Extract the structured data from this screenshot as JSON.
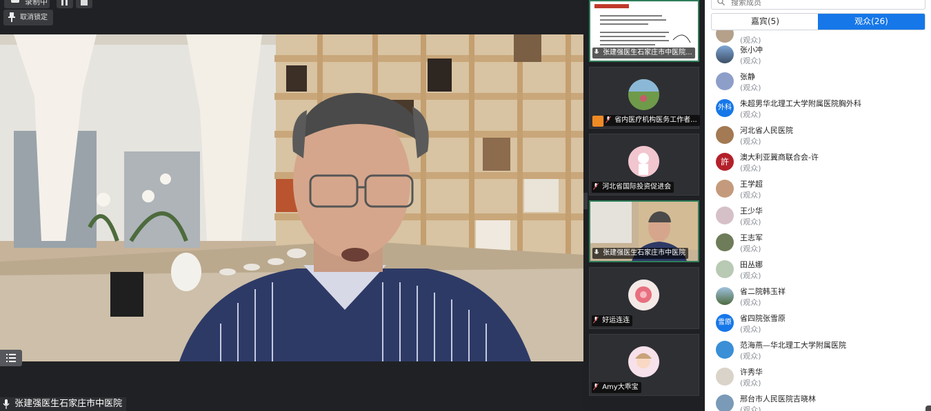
{
  "toolbar": {
    "recording_label": "录制中",
    "unlock_label": "取消锁定"
  },
  "main_video": {
    "speaker_name": "张建强医生石家庄市中医院"
  },
  "thumbnails": [
    {
      "label": "张建强医生石家庄市中医院...",
      "kind": "screen-share",
      "active": true
    },
    {
      "label": "省内医疗机构医务工作者...",
      "kind": "avatar",
      "host": true
    },
    {
      "label": "河北省国际投资促进会",
      "kind": "avatar"
    },
    {
      "label": "张建强医生石家庄市中医院",
      "kind": "video",
      "active": true
    },
    {
      "label": "好运连连",
      "kind": "avatar"
    },
    {
      "label": "Amy大乖宝",
      "kind": "avatar"
    }
  ],
  "panel": {
    "search_placeholder": "搜索成员",
    "tabs": [
      {
        "label": "嘉宾(5)",
        "selected": false
      },
      {
        "label": "观众(26)",
        "selected": true
      }
    ],
    "participants": [
      {
        "name": "",
        "role": "(观众)",
        "avatar": "photo"
      },
      {
        "name": "张小冲",
        "role": "(观众)",
        "avatar": "photo"
      },
      {
        "name": "张静",
        "role": "(观众)",
        "avatar": "photo"
      },
      {
        "name": "朱超男华北理工大学附属医院胸外科",
        "role": "(观众)",
        "avatar": "text",
        "avatar_text": "外科",
        "color": "#1677e8"
      },
      {
        "name": "河北省人民医院",
        "role": "(观众)",
        "avatar": "photo"
      },
      {
        "name": "澳大利亚冀商联合会-许",
        "role": "(观众)",
        "avatar": "text",
        "avatar_text": "許",
        "color": "#b3202a"
      },
      {
        "name": "王学超",
        "role": "(观众)",
        "avatar": "photo"
      },
      {
        "name": "王少华",
        "role": "(观众)",
        "avatar": "photo"
      },
      {
        "name": "王志军",
        "role": "(观众)",
        "avatar": "photo"
      },
      {
        "name": "田丛娜",
        "role": "(观众)",
        "avatar": "photo"
      },
      {
        "name": "省二院韩玉祥",
        "role": "(观众)",
        "avatar": "photo"
      },
      {
        "name": "省四院张雪原",
        "role": "(观众)",
        "avatar": "text",
        "avatar_text": "雪原",
        "color": "#1677e8"
      },
      {
        "name": "范海燕—华北理工大学附属医院",
        "role": "(观众)",
        "avatar": "photo"
      },
      {
        "name": "许秀华",
        "role": "(观众)",
        "avatar": "photo"
      },
      {
        "name": "邢台市人民医院吉晓林",
        "role": "(观众)",
        "avatar": "photo"
      }
    ]
  },
  "colors": {
    "accent": "#1677e8",
    "active_border": "#2f7f5a",
    "bg": "#202124"
  }
}
